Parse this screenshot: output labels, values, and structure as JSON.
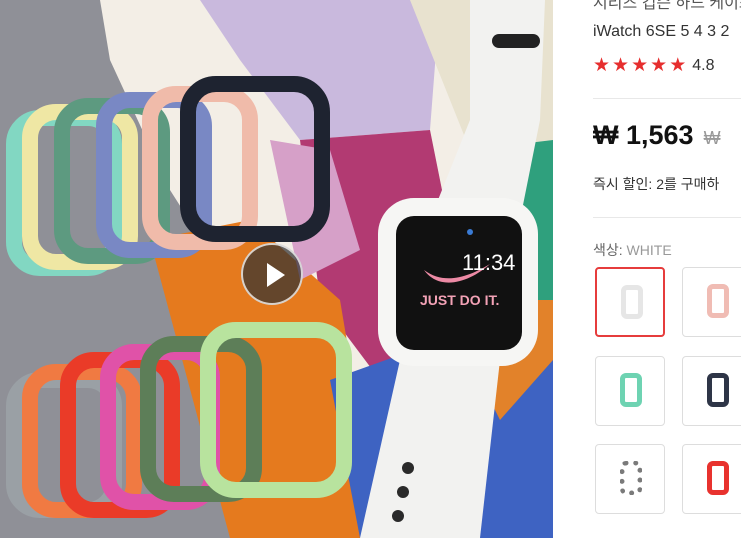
{
  "product": {
    "title_line1": "시리즈 컵슨 하드 케이스 애플",
    "title_line2": "iWatch 6SE 5 4 3 2",
    "rating": {
      "stars": 5,
      "score": "4.8"
    },
    "price": "₩ 1,563",
    "original_price": "₩",
    "discount_text": "즉시 할인: 2를 구매하",
    "color_label": "색상:",
    "color_value": "WHITE",
    "colors": [
      {
        "name": "white",
        "swatch": "#f2f2f2",
        "selected": true
      },
      {
        "name": "pink",
        "swatch": "#f0bcb4",
        "selected": false
      },
      {
        "name": "mint",
        "swatch": "#6ed3b2",
        "selected": false
      },
      {
        "name": "navy",
        "swatch": "#2e3547",
        "selected": false
      },
      {
        "name": "camo",
        "swatch": "#7a7a7a",
        "selected": false
      },
      {
        "name": "red",
        "swatch": "#e8322e",
        "selected": false
      }
    ]
  },
  "watch": {
    "time": "11:34",
    "slogan": "JUST DO IT."
  },
  "colors": {
    "accent": "#e63c3c",
    "star": "#e62e2e"
  },
  "icons": {
    "play": "play-icon",
    "star": "star-icon"
  }
}
